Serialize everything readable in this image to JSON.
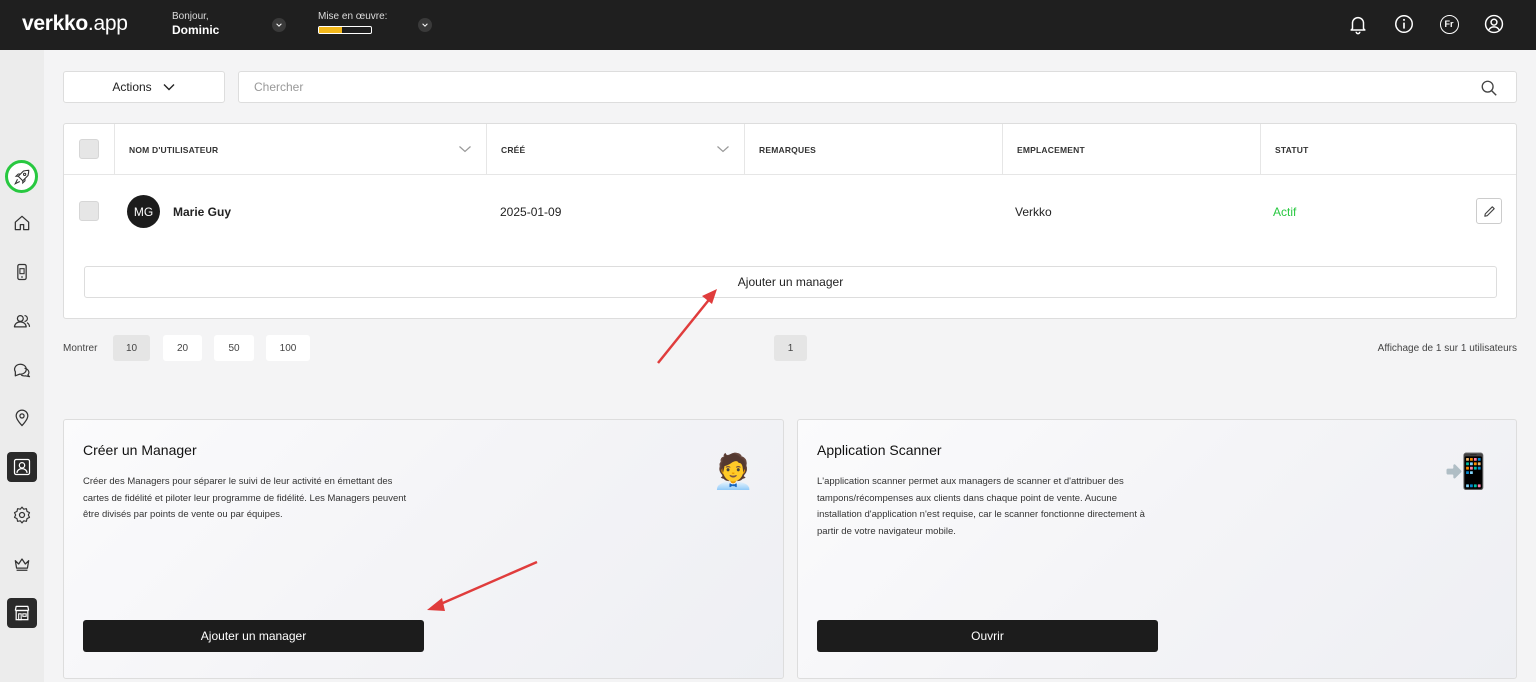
{
  "topbar": {
    "logo_bold": "verkko",
    "logo_rest": ".app",
    "greeting": "Bonjour,",
    "user_name": "Dominic",
    "implementation_label": "Mise en œuvre:",
    "implementation_progress": 0.45,
    "language": "Fr"
  },
  "toolbar": {
    "actions_label": "Actions",
    "search_placeholder": "Chercher"
  },
  "table": {
    "columns": [
      "NOM D'UTILISATEUR",
      "CRÉÉ",
      "REMARQUES",
      "EMPLACEMENT",
      "STATUT"
    ],
    "rows": [
      {
        "initials": "MG",
        "name": "Marie Guy",
        "created": "2025-01-09",
        "remarks": "",
        "location": "Verkko",
        "status": "Actif"
      }
    ],
    "add_label": "Ajouter un manager"
  },
  "pagination": {
    "show_label": "Montrer",
    "sizes": [
      "10",
      "20",
      "50",
      "100"
    ],
    "selected_size": "10",
    "current_page": "1",
    "summary": "Affichage de 1 sur 1 utilisateurs"
  },
  "cards": [
    {
      "title": "Créer un Manager",
      "description": "Créer des Managers pour séparer le suivi de leur activité en émettant des cartes de fidélité et piloter leur programme de fidélité. Les Managers peuvent être divisés par points de vente ou par équipes.",
      "emoji": "🧑‍💼",
      "button": "Ajouter un manager"
    },
    {
      "title": "Application Scanner",
      "description": "L'application scanner permet aux managers de scanner et d'attribuer des tampons/récompenses aux clients dans chaque point de vente. Aucune installation d'application n'est requise, car le scanner fonctionne directement à partir de votre navigateur mobile.",
      "emoji": "📲",
      "button": "Ouvrir"
    }
  ],
  "colors": {
    "topbar": "#1f1f1f",
    "accent_progress": "#f3b81b",
    "status_active": "#28c840",
    "annotation_arrow": "#e03c3c"
  }
}
